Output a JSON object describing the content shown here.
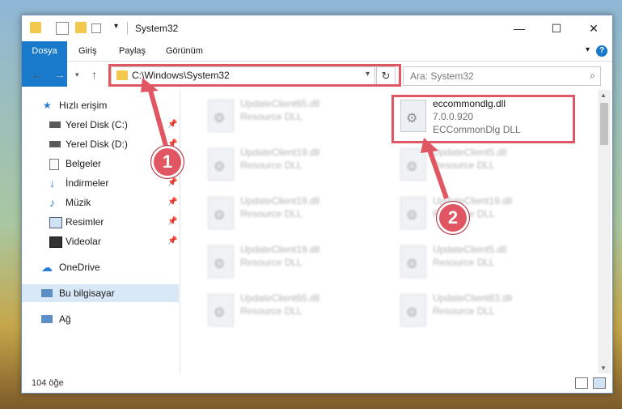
{
  "window": {
    "title": "System32"
  },
  "ribbon": {
    "tabs": [
      "Dosya",
      "Giriş",
      "Paylaş",
      "Görünüm"
    ],
    "help": "?"
  },
  "nav": {
    "address": "C:\\Windows\\System32",
    "search_placeholder": "Ara: System32"
  },
  "sidebar": {
    "items": [
      {
        "label": "Hızlı erişim",
        "icon": "star-icon"
      },
      {
        "label": "Yerel Disk (C:)",
        "icon": "drive-icon",
        "pinned": true
      },
      {
        "label": "Yerel Disk (D:)",
        "icon": "drive-icon",
        "pinned": true
      },
      {
        "label": "Belgeler",
        "icon": "documents-icon",
        "pinned": true
      },
      {
        "label": "İndirmeler",
        "icon": "download-icon",
        "pinned": true
      },
      {
        "label": "Müzik",
        "icon": "music-icon",
        "pinned": true
      },
      {
        "label": "Resimler",
        "icon": "pictures-icon",
        "pinned": true
      },
      {
        "label": "Videolar",
        "icon": "videos-icon",
        "pinned": true
      },
      {
        "label": "OneDrive",
        "icon": "cloud-icon"
      },
      {
        "label": "Bu bilgisayar",
        "icon": "computer-icon",
        "selected": true
      },
      {
        "label": "Ağ",
        "icon": "network-icon"
      }
    ]
  },
  "files": {
    "highlighted": {
      "name": "eccommondlg.dll",
      "version": "7.0.0.920",
      "description": "ECCommonDlg DLL"
    },
    "left": [
      {
        "name": "UpdateClient65.dll",
        "desc": "Resource DLL"
      },
      {
        "name": "UpdateClient19.dll",
        "desc": "Resource DLL"
      },
      {
        "name": "UpdateClient19.dll",
        "desc": "Resource DLL"
      },
      {
        "name": "UpdateClient19.dll",
        "desc": "Resource DLL"
      },
      {
        "name": "UpdateClient65.dll",
        "desc": "Resource DLL"
      }
    ],
    "right": [
      {
        "name": "UpdateClient5.dll",
        "desc": "Resource DLL"
      },
      {
        "name": "UpdateClient19.dll",
        "desc": "Resource DLL"
      },
      {
        "name": "UpdateClient5.dll",
        "desc": "Resource DLL"
      },
      {
        "name": "UpdateClient63.dll",
        "desc": "Resource DLL"
      }
    ]
  },
  "status": {
    "count": "104 öğe"
  },
  "annotations": {
    "step1": "1",
    "step2": "2",
    "color": "#e05662"
  }
}
